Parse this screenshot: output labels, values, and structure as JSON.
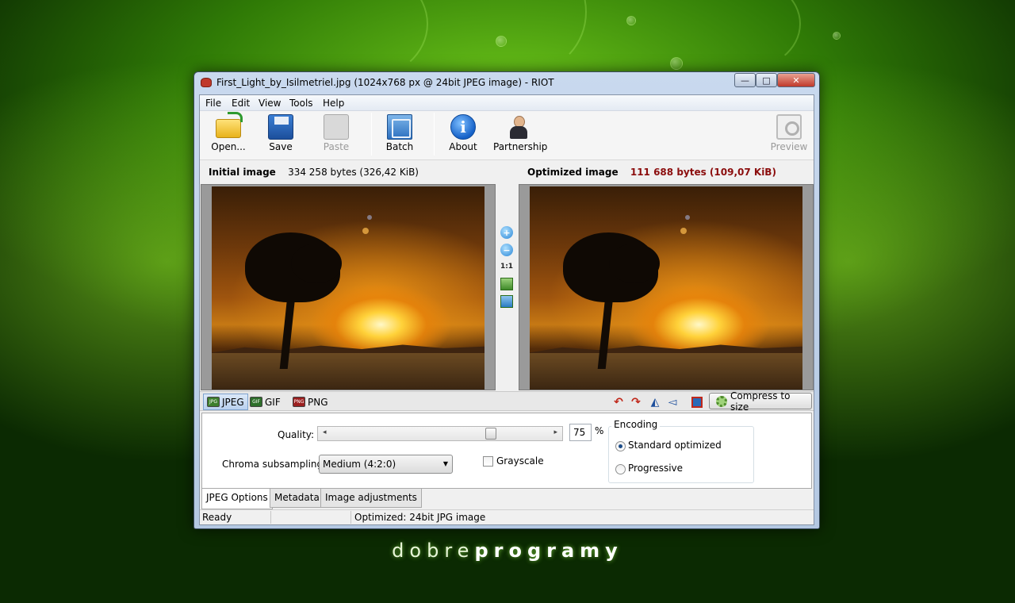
{
  "brand": {
    "light": "dobre",
    "bold": "programy"
  },
  "window": {
    "title": "First_Light_by_Isilmetriel.jpg (1024x768 px @ 24bit JPEG image) - RIOT",
    "min_glyph": "—",
    "max_glyph": "□",
    "close_glyph": "✕"
  },
  "menu": {
    "file": "File",
    "edit": "Edit",
    "view": "View",
    "tools": "Tools",
    "help": "Help"
  },
  "toolbar": {
    "open": "Open...",
    "save": "Save",
    "paste": "Paste",
    "batch": "Batch",
    "about": "About",
    "about_glyph": "i",
    "partnership": "Partnership",
    "preview": "Preview"
  },
  "initial": {
    "label": "Initial image",
    "size": "334 258 bytes (326,42 KiB)"
  },
  "optimized": {
    "label": "Optimized image",
    "size": "111 688 bytes (109,07 KiB)"
  },
  "zoom": {
    "in": "+",
    "out": "−",
    "actual": "1:1"
  },
  "formats": {
    "jpeg": "JPEG",
    "gif": "GIF",
    "png": "PNG",
    "jpeg_icon": "JPG",
    "gif_icon": "GIF",
    "png_icon": "PNG"
  },
  "tools": {
    "rotate_left": "↶",
    "rotate_right": "↷",
    "flip_h": "◭",
    "flip_v": "◅",
    "compress": "Compress to size"
  },
  "options": {
    "quality_label": "Quality:",
    "quality_value": "75",
    "quality_unit": "%",
    "quality_fraction": 0.75,
    "chroma_label": "Chroma subsampling:",
    "chroma_value": "Medium (4:2:0)",
    "grayscale_label": "Grayscale",
    "grayscale_checked": false,
    "encoding_title": "Encoding",
    "encoding_standard": "Standard optimized",
    "encoding_progressive": "Progressive",
    "encoding_selected": "Standard optimized"
  },
  "option_tabs": [
    "JPEG Options",
    "Metadata",
    "Image adjustments"
  ],
  "status": {
    "ready": "Ready",
    "info": "Optimized: 24bit JPG image"
  },
  "colors": {
    "accent": "#8b0d0d",
    "selected_tab": "#b9d1ef",
    "background": "#2f7a06"
  }
}
